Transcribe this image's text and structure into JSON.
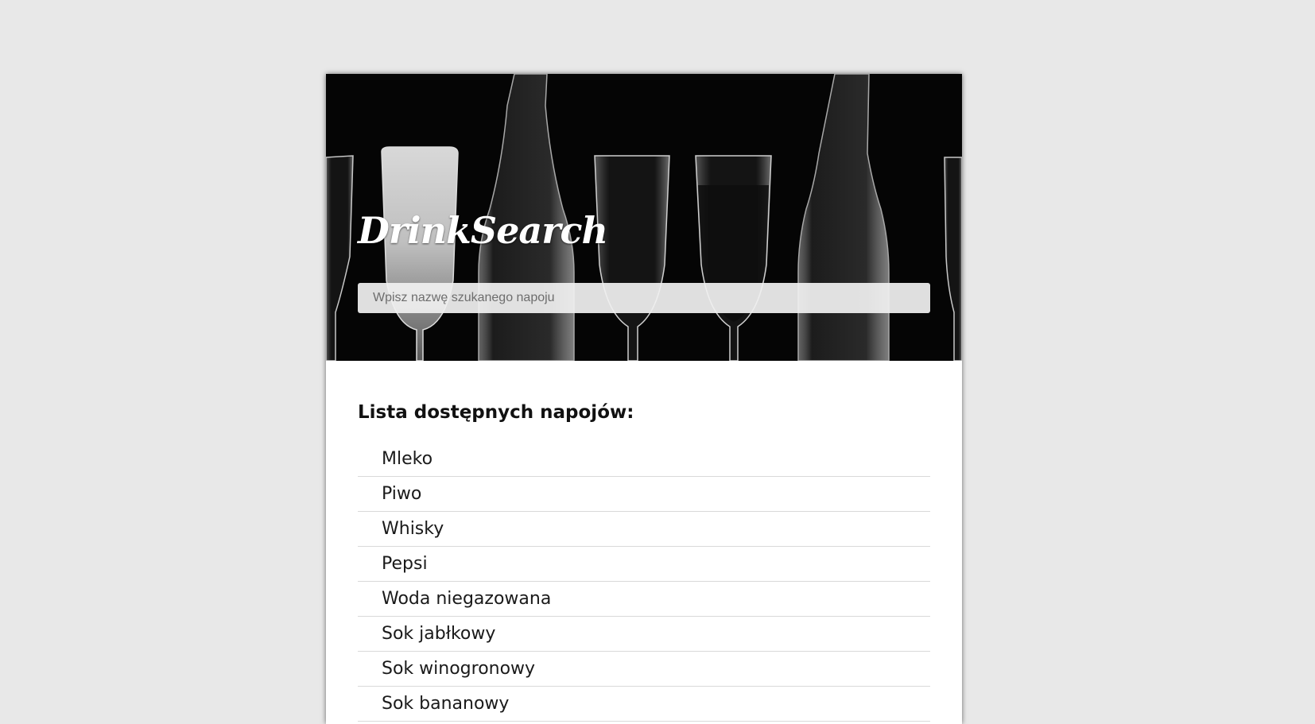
{
  "app": {
    "title": "DrinkSearch"
  },
  "search": {
    "placeholder": "Wpisz nazwę szukanego napoju",
    "value": ""
  },
  "list": {
    "heading": "Lista dostępnych napojów:",
    "items": [
      "Mleko",
      "Piwo",
      "Whisky",
      "Pepsi",
      "Woda niegazowana",
      "Sok jabłkowy",
      "Sok winogronowy",
      "Sok bananowy"
    ]
  },
  "colors": {
    "page_background": "#e8e8e8",
    "hero_background": "#050505",
    "card_background": "#ffffff",
    "text": "#1a1a1a",
    "divider": "#d9d9d9"
  },
  "icons": {
    "hero_image": "glasses-and-bottles-photo"
  }
}
